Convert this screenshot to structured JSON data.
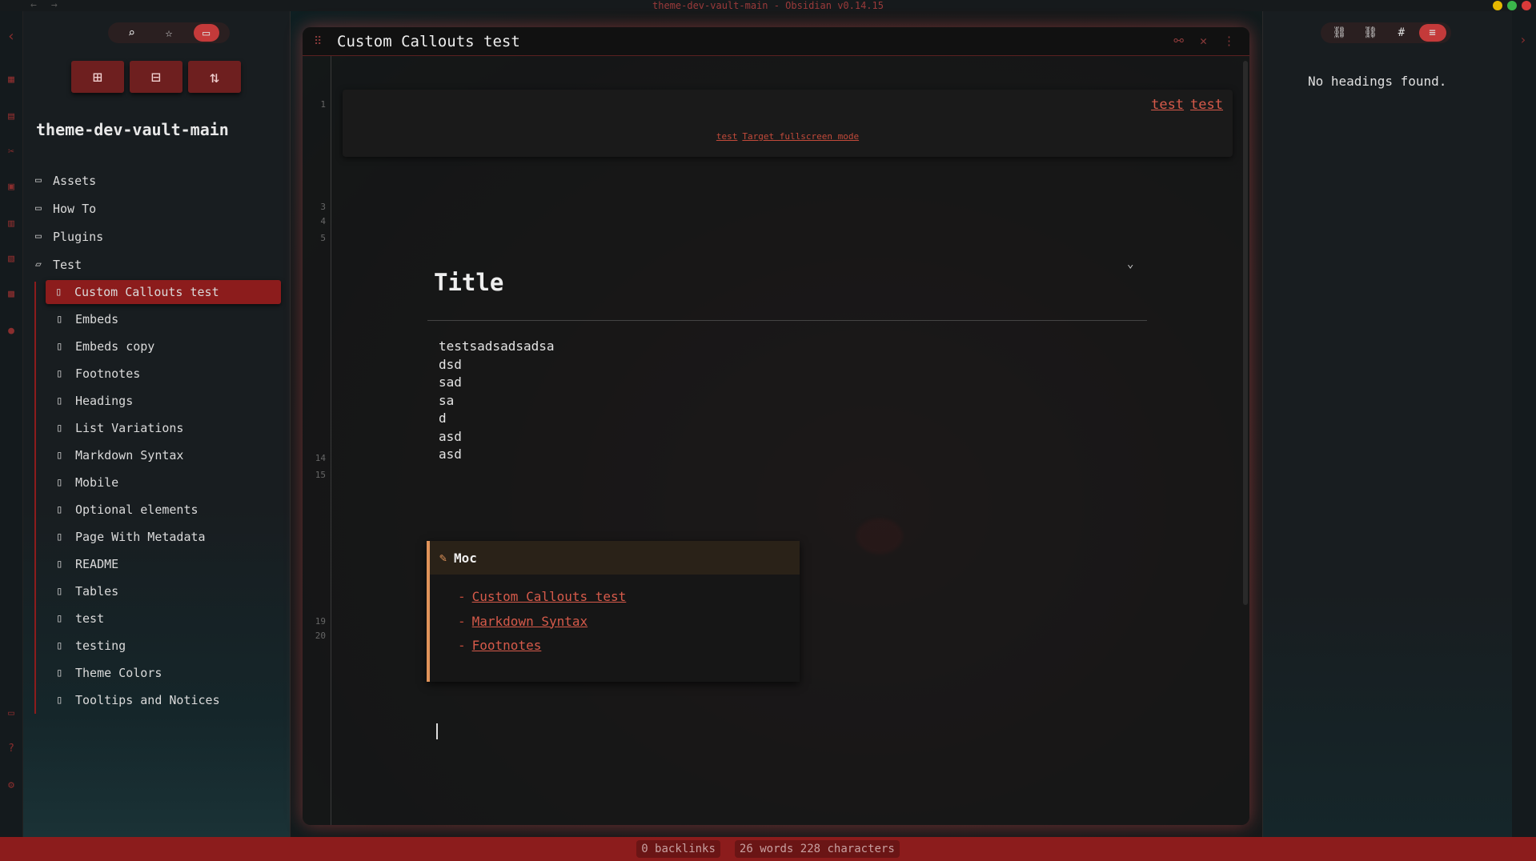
{
  "window": {
    "title": "theme-dev-vault-main - Obsidian v0.14.15",
    "nav_back": "←",
    "nav_forward": "→",
    "traffic_colors": [
      "#e6b800",
      "#3ab54a",
      "#d93a3a"
    ]
  },
  "ribbon": {
    "collapse": "‹",
    "top_icons": [
      "calendar-icon",
      "daily-note-icon",
      "graph-icon",
      "date-icon",
      "template-icon",
      "slides-icon",
      "command-icon",
      "audio-icon"
    ],
    "top_glyphs": [
      "▦",
      "▤",
      "✂",
      "▣",
      "▥",
      "▧",
      "▩",
      "●"
    ],
    "bottom_icons": [
      "vault-icon",
      "help-icon",
      "settings-icon"
    ],
    "bottom_glyphs": [
      "▭",
      "?",
      "⚙"
    ]
  },
  "left_sidebar": {
    "tabs": [
      {
        "name": "search-icon",
        "glyph": "⌕"
      },
      {
        "name": "star-icon",
        "glyph": "☆"
      },
      {
        "name": "folder-icon",
        "glyph": "▭"
      }
    ],
    "actions": [
      {
        "name": "new-note-button",
        "glyph": "⊞"
      },
      {
        "name": "new-folder-button",
        "glyph": "⊟"
      },
      {
        "name": "sort-button",
        "glyph": "⇅"
      }
    ],
    "vault_name": "theme-dev-vault-main",
    "folders": [
      "Assets",
      "How To",
      "Plugins",
      "Test"
    ],
    "files": [
      "Custom Callouts test",
      "Embeds",
      "Embeds copy",
      "Footnotes",
      "Headings",
      "List Variations",
      "Markdown Syntax",
      "Mobile",
      "Optional elements",
      "Page With Metadata",
      "README",
      "Tables",
      "test",
      "testing",
      "Theme Colors",
      "Tooltips and Notices"
    ],
    "active_file": "Custom Callouts test"
  },
  "pane": {
    "title": "Custom Callouts test",
    "line_numbers": [
      "1",
      "3",
      "4",
      "5",
      "14",
      "15",
      "19",
      "20"
    ],
    "banner_right": [
      "test",
      "test"
    ],
    "banner_center": [
      "test",
      "Target fullscreen mode"
    ],
    "heading": "Title",
    "paragraph_lines": [
      "testsadsadsadsa",
      "dsd",
      "sad",
      "sa",
      "d",
      "asd",
      "asd"
    ],
    "callout": {
      "title": "Moc",
      "links": [
        "Custom Callouts test",
        "Markdown Syntax",
        "Footnotes"
      ],
      "accent": "#e0935a"
    }
  },
  "right_sidebar": {
    "tabs": [
      {
        "name": "backlinks-icon",
        "glyph": "⛓"
      },
      {
        "name": "outgoing-links-icon",
        "glyph": "⛓"
      },
      {
        "name": "tags-icon",
        "glyph": "#"
      },
      {
        "name": "outline-icon",
        "glyph": "≡"
      }
    ],
    "empty_message": "No headings found.",
    "collapse": "›"
  },
  "status_bar": {
    "backlinks": "0 backlinks",
    "counts": "26 words 228 characters"
  },
  "colors": {
    "accent": "#c43a3a",
    "status_bar": "#8c1c1c",
    "link": "#d65a4a"
  }
}
